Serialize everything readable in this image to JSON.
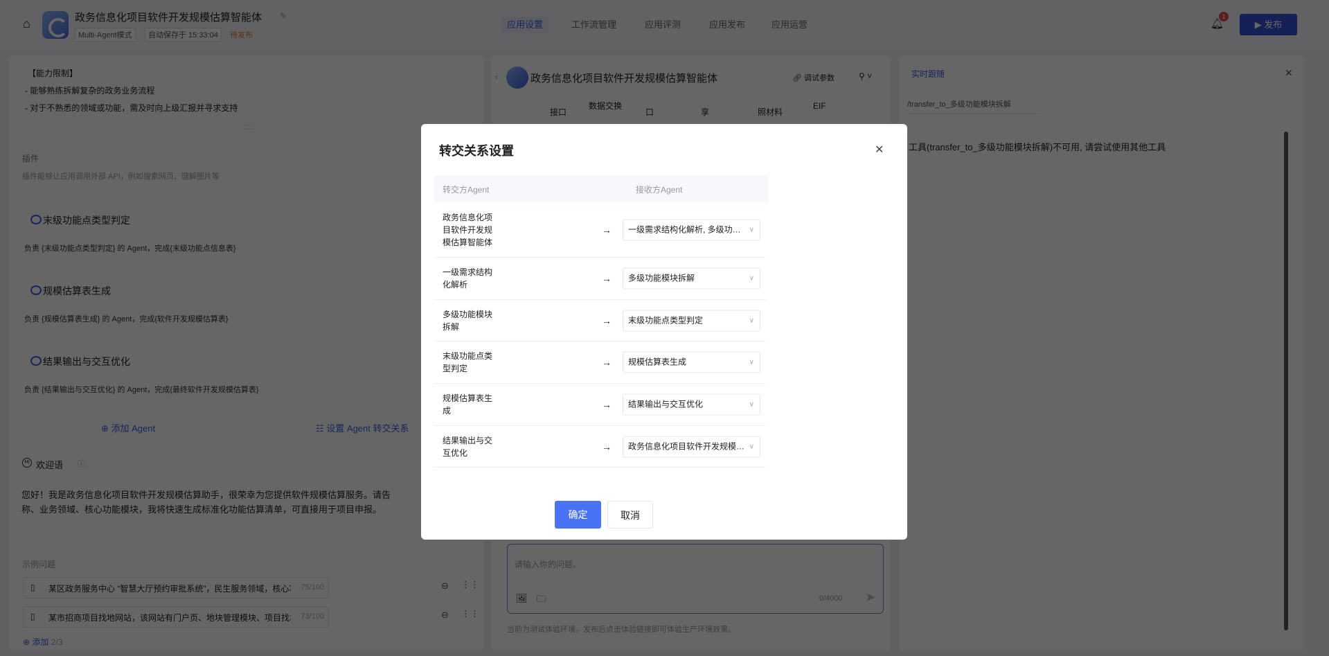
{
  "header": {
    "title": "政务信息化项目软件开发规模估算智能体",
    "mode": "Multi-Agent模式",
    "autosave": "自动保存于 15:33:04",
    "status": "待发布",
    "tabs": [
      "应用设置",
      "工作流管理",
      "应用评测",
      "应用发布",
      "应用运营"
    ],
    "notification_count": "1",
    "publish_label": "发布"
  },
  "left": {
    "capability_title": "【能力限制】",
    "capability_lines": [
      "- 能够熟练拆解复杂的政务业务流程",
      "- 对于不熟悉的领域或功能，需及时向上级汇报并寻求支持"
    ],
    "plugins_title": "插件",
    "plugins_desc": "插件能够让应用调用外部 API，例如搜索网页、理解图片等",
    "agents": [
      {
        "name": "末级功能点类型判定",
        "desc": "负责 {末级功能点类型判定} 的 Agent，完成{末级功能点信息表}"
      },
      {
        "name": "规模估算表生成",
        "desc": "负责 {规模估算表生成} 的 Agent，完成{软件开发规模估算表}"
      },
      {
        "name": "结果输出与交互优化",
        "desc": "负责 {结果输出与交互优化} 的 Agent，完成{最终软件开发规模估算表}"
      }
    ],
    "add_agent": "添加 Agent",
    "set_transfer": "设置 Agent 转交关系",
    "welcome_title": "欢迎语",
    "welcome_lines": [
      "您好！我是政务信息化项目软件开发规模估算助手，很荣幸为您提供软件规模估算服务。请告",
      "称、业务领域、核心功能模块，我将快速生成标准化功能估算清单，可直接用于项目申报。"
    ],
    "examples_title": "示例问题",
    "examples": [
      {
        "text": "某区政务服务中心 “智慧大厅预约审批系统”，民生服务领域，核心功能含预约挂号",
        "count": "75/100"
      },
      {
        "text": "某市招商项目找地网站，该网站有门户页、地块管理模块、项目找地模块，帮我生",
        "count": "73/100"
      }
    ],
    "add_example": "添加",
    "example_count": "2/3"
  },
  "middle": {
    "title": "政务信息化项目软件开发规模估算智能体",
    "debug_params": "调试参数",
    "table_fragments": [
      "接口",
      "数据交换",
      "口",
      "享",
      "照材料",
      "EIF"
    ],
    "input_placeholder": "请输入你的问题。",
    "char_counter": "0/4000",
    "footer_note": "当前为测试体验环境，发布后点击体验链接即可体验生产环境效果。"
  },
  "right": {
    "tab": "实时跟随",
    "path": "/transfer_to_多级功能模块拆解",
    "message": "工具(transfer_to_多级功能模块拆解)不可用, 请尝试使用其他工具"
  },
  "modal": {
    "title": "转交关系设置",
    "col_from": "转交方Agent",
    "col_to": "接收方Agent",
    "rows": [
      {
        "from": "政务信息化项目软件开发规模估算智能体",
        "to": "一级需求结构化解析, 多级功能模块拆解"
      },
      {
        "from": "一级需求结构化解析",
        "to": "多级功能模块拆解"
      },
      {
        "from": "多级功能模块拆解",
        "to": "末级功能点类型判定"
      },
      {
        "from": "末级功能点类型判定",
        "to": "规模估算表生成"
      },
      {
        "from": "规模估算表生成",
        "to": "结果输出与交互优化"
      },
      {
        "from": "结果输出与交互优化",
        "to": "政务信息化项目软件开发规模估算智能体"
      }
    ],
    "confirm": "确定",
    "cancel": "取消"
  },
  "colors": {
    "accent": "#3d5de0",
    "confirm": "#4a72f5",
    "status": "#e07a2e"
  }
}
